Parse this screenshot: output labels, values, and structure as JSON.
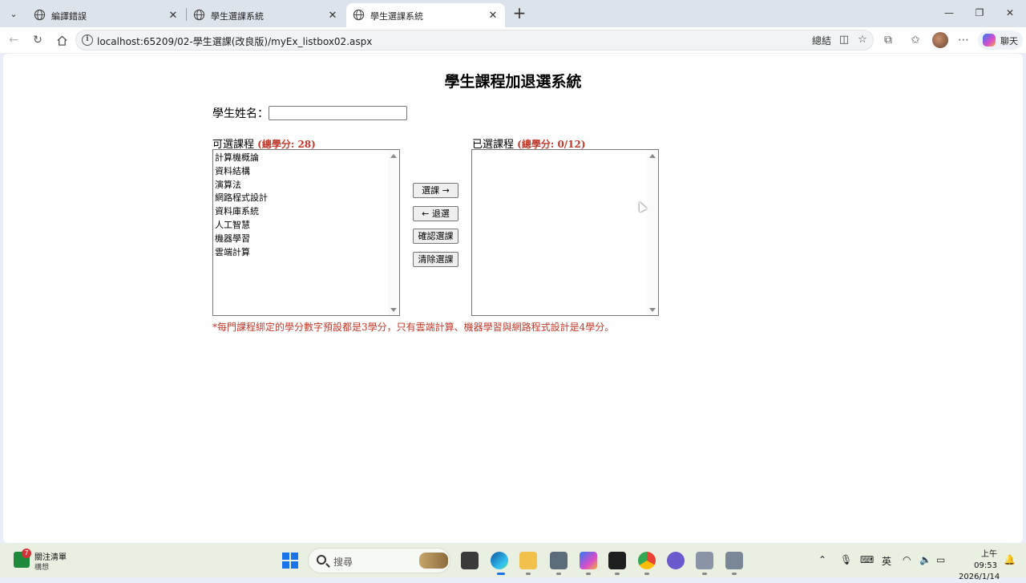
{
  "browser": {
    "tabs": [
      {
        "title": "編譯錯誤",
        "active": false
      },
      {
        "title": "學生選課系統",
        "active": false
      },
      {
        "title": "學生選課系統",
        "active": true
      }
    ],
    "address": {
      "url": "localhost:65209/02-學生選課(改良版)/myEx_listbox02.aspx",
      "read_aloud_label": "總結"
    },
    "copilot_label": "聊天",
    "icons": [
      "globe-icon",
      "back-icon",
      "refresh-icon",
      "home-icon",
      "info-icon",
      "favorite-icon",
      "extensions-icon",
      "favorites-list-icon",
      "more-icon"
    ]
  },
  "page": {
    "heading": "學生課程加退選系統",
    "name_label": "學生姓名：",
    "name_value": "",
    "available": {
      "label": "可選課程",
      "credit_text": "(總學分: 28)",
      "courses": [
        "計算機概論",
        "資料結構",
        "演算法",
        "網路程式設計",
        "資料庫系統",
        "人工智慧",
        "機器學習",
        "雲端計算"
      ]
    },
    "selected": {
      "label": "已選課程",
      "credit_text": "(總學分: 0/12)",
      "courses": []
    },
    "buttons": {
      "add": "選課 →",
      "remove": "← 退選",
      "confirm": "確認選課",
      "clear": "清除選課"
    },
    "footnote": "*每門課程綁定的學分數字預設都是3學分，只有雲端計算、機器學習與網路程式設計是4學分。",
    "colors": {
      "accent": "#c0392b"
    }
  },
  "taskbar": {
    "weather_badge": "7",
    "weather_title": "關注清單",
    "weather_sub": "構想",
    "search_placeholder": "搜尋",
    "ime": "英",
    "time": "上午 09:53",
    "date": "2026/1/14"
  }
}
